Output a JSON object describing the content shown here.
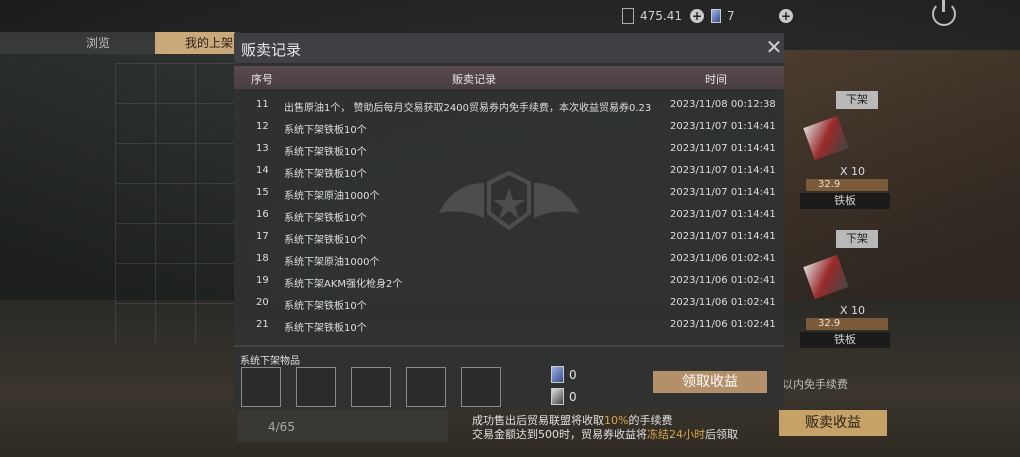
{
  "top_bar": {
    "resource_value": "475.41",
    "voucher_count": "7"
  },
  "tabs": {
    "browse": "浏览",
    "my_listings": "我的上架"
  },
  "listings": [
    {
      "down_label": "下架",
      "qty": "X 10",
      "price": "32.9",
      "name": "铁板"
    },
    {
      "down_label": "下架",
      "qty": "X 10",
      "price": "32.9",
      "name": "铁板"
    }
  ],
  "background": {
    "free_fee_text": "以内免手续费",
    "counter": "4/65",
    "sell_income_button": "贩卖收益",
    "fee_info_1_pre": "成功售出后贸易联盟将收取",
    "fee_info_1_hl": "10%",
    "fee_info_1_post": "的手续费",
    "fee_info_2_pre": "交易金额达到500时，贸易券收益将",
    "fee_info_2_hl": "冻结24小时",
    "fee_info_2_post": "后领取"
  },
  "modal": {
    "title": "贩卖记录",
    "close_icon": "close-icon",
    "headers": {
      "no": "序号",
      "record": "贩卖记录",
      "time": "时间"
    },
    "rows": [
      {
        "no": "11",
        "record": "出售原油1个， 赞助后每月交易获取2400贸易券内免手续费，本次收益贸易券0.23",
        "time": "2023/11/08 00:12:38"
      },
      {
        "no": "12",
        "record": "系统下架铁板10个",
        "time": "2023/11/07 01:14:41"
      },
      {
        "no": "13",
        "record": "系统下架铁板10个",
        "time": "2023/11/07 01:14:41"
      },
      {
        "no": "14",
        "record": "系统下架铁板10个",
        "time": "2023/11/07 01:14:41"
      },
      {
        "no": "15",
        "record": "系统下架原油1000个",
        "time": "2023/11/07 01:14:41"
      },
      {
        "no": "16",
        "record": "系统下架铁板10个",
        "time": "2023/11/07 01:14:41"
      },
      {
        "no": "17",
        "record": "系统下架铁板10个",
        "time": "2023/11/07 01:14:41"
      },
      {
        "no": "18",
        "record": "系统下架原油1000个",
        "time": "2023/11/06 01:02:41"
      },
      {
        "no": "19",
        "record": "系统下架AKM强化枪身2个",
        "time": "2023/11/06 01:02:41"
      },
      {
        "no": "20",
        "record": "系统下架铁板10个",
        "time": "2023/11/06 01:02:41"
      },
      {
        "no": "21",
        "record": "系统下架铁板10个",
        "time": "2023/11/06 01:02:41"
      }
    ],
    "system_delisted_label": "系统下架物品",
    "currency_1_count": "0",
    "currency_2_count": "0",
    "claim_button": "领取收益"
  }
}
